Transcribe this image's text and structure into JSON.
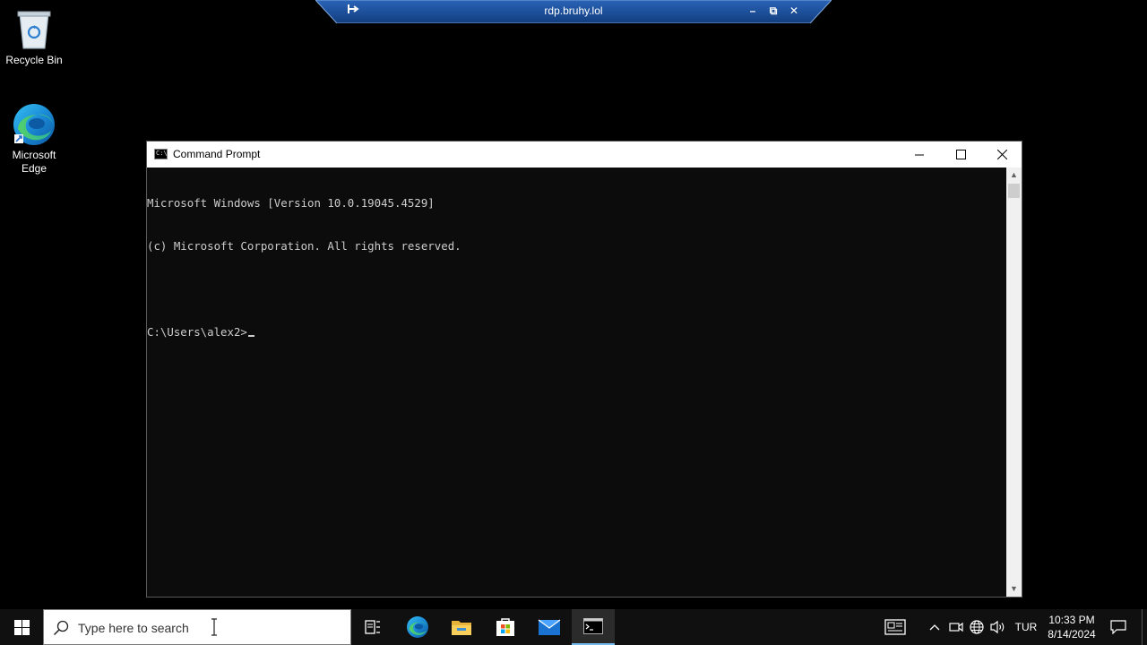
{
  "desktop": {
    "icons": [
      {
        "label": "Recycle Bin",
        "icon": "recycle-bin-icon"
      },
      {
        "label": "Microsoft Edge",
        "icon": "edge-icon"
      }
    ]
  },
  "rdp_bar": {
    "title": "rdp.bruhy.lol",
    "pin_icon": "pin-icon",
    "minimize_glyph": "–",
    "restore_glyph": "⧉",
    "close_glyph": "✕"
  },
  "cmd_window": {
    "title": "Command Prompt",
    "lines": [
      "Microsoft Windows [Version 10.0.19045.4529]",
      "(c) Microsoft Corporation. All rights reserved.",
      "",
      "C:\\Users\\alex2>"
    ],
    "scroll_up_glyph": "▲",
    "scroll_down_glyph": "▼"
  },
  "taskbar": {
    "search_placeholder": "Type here to search",
    "apps": [
      "task-view-icon",
      "edge-icon",
      "file-explorer-icon",
      "store-icon",
      "mail-icon",
      "command-prompt-icon"
    ],
    "tray": {
      "language": "TUR",
      "time": "10:33 PM",
      "date": "8/14/2024"
    }
  },
  "colors": {
    "cmd_background": "#0c0c0c",
    "cmd_text": "#cccccc",
    "taskbar": "#101010",
    "rdp_bar": "#1f4f9a"
  }
}
